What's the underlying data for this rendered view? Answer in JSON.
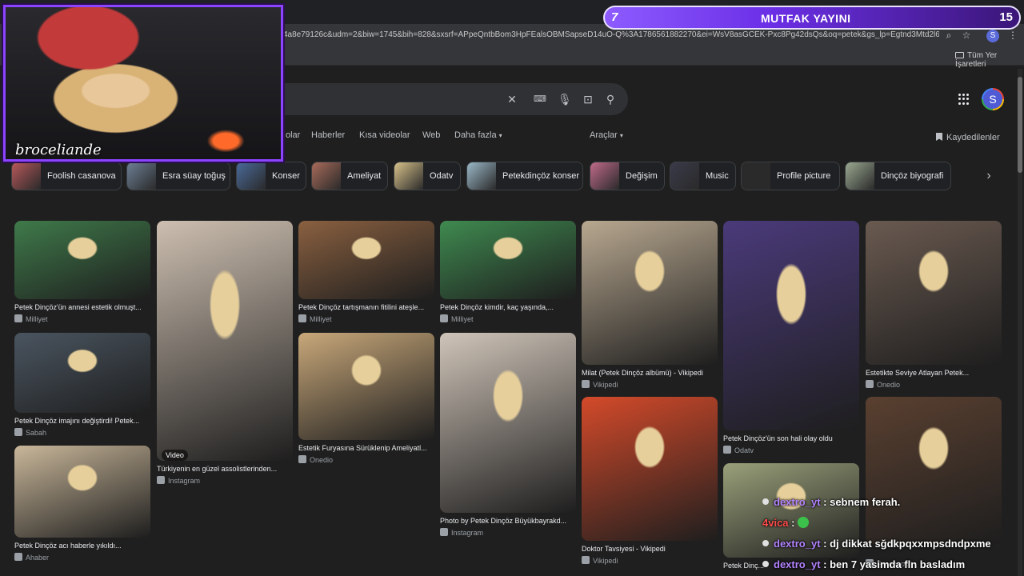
{
  "browser": {
    "url": "4a8e79126c&udm=2&biw=1745&bih=828&sxsrf=APpeQntbBom3HpFEalsOBMSapseD14uO-Q%3A1786561882270&ei=WsV8asGCEK-Pxc8Pg42dsQs&oq=petek&gs_lp=Egtnd3Mtd2l6LWltZylFcGV...",
    "bookmarks_label": "Tüm Yer İşaretleri",
    "profile_initial": "S"
  },
  "search": {
    "account_initial": "S"
  },
  "nav": {
    "tabs": [
      "olar",
      "Haberler",
      "Kısa videolar",
      "Web",
      "Daha fazla",
      "Araçlar"
    ],
    "saved_label": "Kaydedilenler"
  },
  "chips": [
    {
      "label": "Foolish casanova",
      "color": "#b8585a"
    },
    {
      "label": "Esra süay toğuş",
      "color": "#6d7f95"
    },
    {
      "label": "Konser",
      "color": "#4a6a9a"
    },
    {
      "label": "Ameliyat",
      "color": "#a86b5a"
    },
    {
      "label": "Odatv",
      "color": "#d8c28a"
    },
    {
      "label": "Petekdinçöz konser",
      "color": "#9bb8c8"
    },
    {
      "label": "Değişim",
      "color": "#c06a8a"
    },
    {
      "label": "Music",
      "color": "#3a3a4a"
    },
    {
      "label": "Profile picture",
      "color": "#2a2a2a"
    },
    {
      "label": "Dinçöz biyografi",
      "color": "#9aa890"
    }
  ],
  "results": [
    {
      "caption": "Petek Dinçöz'ün annesi estetik olmuşt...",
      "source": "Milliyet",
      "color": "#3f7a4a"
    },
    {
      "caption": "Petek Dinçöz imajını değiştirdi! Petek...",
      "source": "Sabah",
      "color": "#4a5560"
    },
    {
      "caption": "Petek Dinçöz acı haberle yıkıldı...",
      "source": "Ahaber",
      "color": "#c9b79a"
    },
    {
      "caption": "Türkiyenin en güzel assolistlerinden...",
      "source": "Instagram",
      "color": "#cdbfb0",
      "badge": "Video"
    },
    {
      "caption": "Petek Dinçöz tartışmanın fitilini ateşle...",
      "source": "Milliyet",
      "color": "#8a6040"
    },
    {
      "caption": "Estetik Furyasına Sürüklenip Ameliyatl...",
      "source": "Onedio",
      "color": "#c9a87a"
    },
    {
      "caption": "Petek Dinçöz kimdir, kaç yaşında,...",
      "source": "Milliyet",
      "color": "#3f8a50"
    },
    {
      "caption": "Photo by Petek Dinçöz Büyükbayrakd...",
      "source": "Instagram",
      "color": "#cfc4b8"
    },
    {
      "caption": "Milat (Petek Dinçöz albümü) - Vikipedi",
      "source": "Vikipedi",
      "color": "#b8a890"
    },
    {
      "caption": "Doktor Tavsiyesi - Vikipedi",
      "source": "Vikipedi",
      "color": "#d44a2a"
    },
    {
      "caption": "Petek Dinçöz'ün son hali olay oldu",
      "source": "Odatv",
      "color": "#4a3a7a"
    },
    {
      "caption": "Petek Dinç...",
      "source": "",
      "color": "#9aa07a"
    },
    {
      "caption": "Estetikte Seviye Atlayan Petek...",
      "source": "Onedio",
      "color": "#6a5a50"
    },
    {
      "caption": "",
      "source": "Facebook",
      "color": "#5a4030"
    }
  ],
  "overlay": {
    "streamer_name": "broceliande",
    "banner_title": "MUTFAK YAYINI",
    "banner_left_number": "7",
    "banner_right_number": "15"
  },
  "chat": [
    {
      "user": "dextro_yt",
      "message": ": sebnem ferah."
    },
    {
      "user": "4vica",
      "message": ":"
    },
    {
      "user": "dextro_yt",
      "message": ": dj dikkat sğdkpqxxmpsdndpxme"
    },
    {
      "user": "dextro_yt",
      "message": ": ben 7 yasimda fln basladım"
    }
  ],
  "colors": {
    "accent": "#8b44ff",
    "background": "#1f1f1f"
  }
}
